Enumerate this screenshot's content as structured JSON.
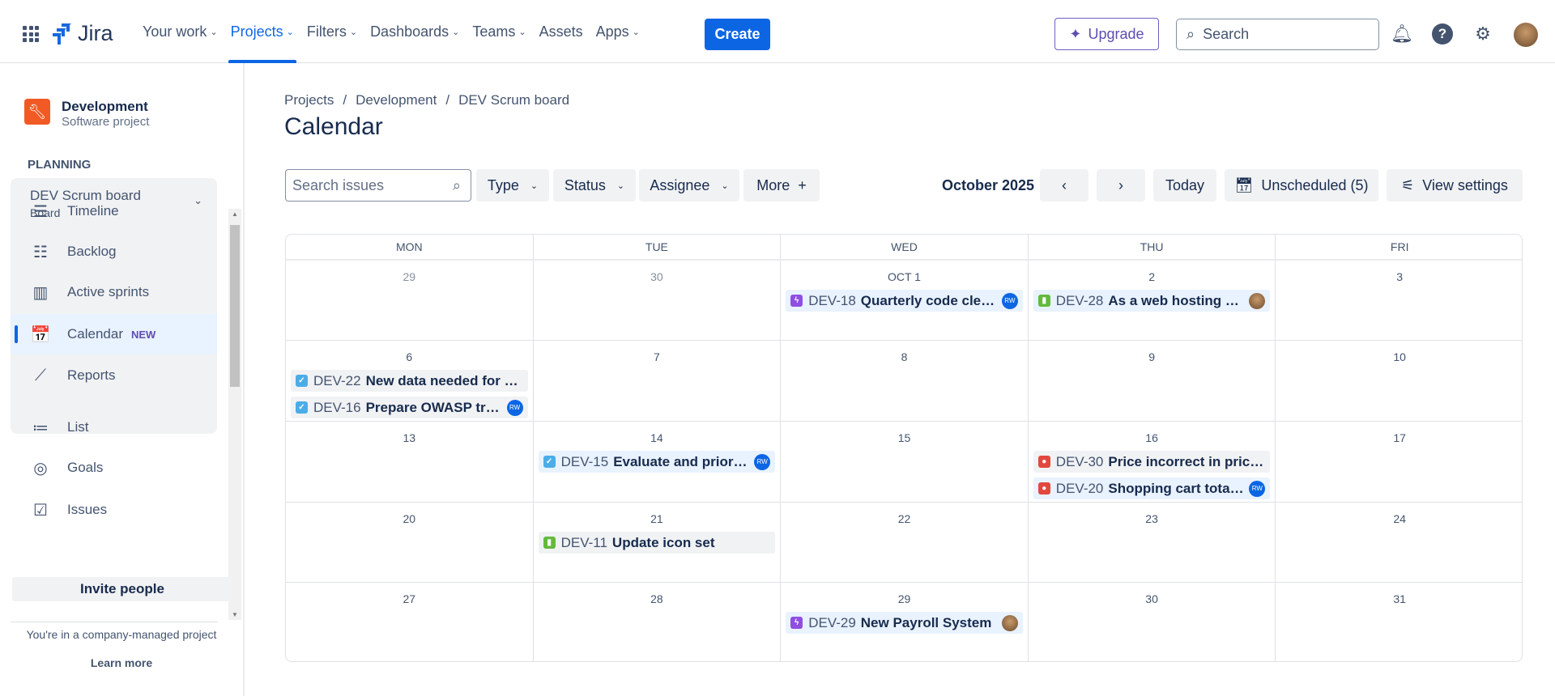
{
  "nav": {
    "logo": "Jira",
    "items": [
      {
        "label": "Your work",
        "chev": true
      },
      {
        "label": "Projects",
        "chev": true,
        "active": true
      },
      {
        "label": "Filters",
        "chev": true
      },
      {
        "label": "Dashboards",
        "chev": true
      },
      {
        "label": "Teams",
        "chev": true
      },
      {
        "label": "Assets",
        "chev": false
      },
      {
        "label": "Apps",
        "chev": true
      }
    ],
    "create": "Create",
    "upgrade": "Upgrade",
    "search_placeholder": "Search"
  },
  "sidebar": {
    "project_name": "Development",
    "project_type": "Software project",
    "section": "PLANNING",
    "board_name": "DEV Scrum board",
    "board_type": "Board",
    "items": [
      {
        "label": "Timeline",
        "icon": "☰"
      },
      {
        "label": "Backlog",
        "icon": "☷"
      },
      {
        "label": "Active sprints",
        "icon": "▥"
      },
      {
        "label": "Calendar",
        "icon": "📅",
        "badge": "NEW"
      },
      {
        "label": "Reports",
        "icon": "⟋"
      },
      {
        "label": "List",
        "icon": "≔"
      },
      {
        "label": "Goals",
        "icon": "◎"
      },
      {
        "label": "Issues",
        "icon": "☑"
      }
    ],
    "invite": "Invite people",
    "company_note": "You're in a company-managed project",
    "learn_more": "Learn more"
  },
  "breadcrumb": [
    "Projects",
    "Development",
    "DEV Scrum board"
  ],
  "title": "Calendar",
  "toolbar": {
    "search_placeholder": "Search issues",
    "filters": [
      "Type",
      "Status",
      "Assignee"
    ],
    "more": "More",
    "month": "October 2025",
    "today": "Today",
    "unscheduled": "Unscheduled (5)",
    "view_settings": "View settings"
  },
  "colors": {
    "task": "#4bade8",
    "story": "#63ba3c",
    "epic": "#904ee2",
    "bug": "#e2483d"
  },
  "calendar": {
    "days": [
      "MON",
      "TUE",
      "WED",
      "THU",
      "FRI"
    ],
    "weeks": [
      [
        {
          "d": "29",
          "muted": true
        },
        {
          "d": "30",
          "muted": true
        },
        {
          "d": "OCT 1",
          "events": [
            {
              "type": "epic",
              "key": "DEV-18",
              "summary": "Quarterly code cleanup",
              "assignee": "RW",
              "blue": true
            }
          ]
        },
        {
          "d": "2",
          "events": [
            {
              "type": "story",
              "key": "DEV-28",
              "summary": "As a web hosting customer",
              "assignee": "photo",
              "blue": true
            }
          ]
        },
        {
          "d": "3"
        }
      ],
      [
        {
          "d": "6",
          "events": [
            {
              "type": "task",
              "key": "DEV-22",
              "summary": "New data needed for campaign"
            },
            {
              "type": "task",
              "key": "DEV-16",
              "summary": "Prepare OWASP training",
              "assignee": "RW"
            }
          ]
        },
        {
          "d": "7"
        },
        {
          "d": "8"
        },
        {
          "d": "9"
        },
        {
          "d": "10"
        }
      ],
      [
        {
          "d": "13"
        },
        {
          "d": "14",
          "events": [
            {
              "type": "task",
              "key": "DEV-15",
              "summary": "Evaluate and prioritize",
              "assignee": "RW",
              "blue": true
            }
          ]
        },
        {
          "d": "15"
        },
        {
          "d": "16",
          "events": [
            {
              "type": "bug",
              "key": "DEV-30",
              "summary": "Price incorrect in pricing page"
            },
            {
              "type": "bug",
              "key": "DEV-20",
              "summary": "Shopping cart total wrong",
              "assignee": "RW",
              "blue": true
            }
          ]
        },
        {
          "d": "17"
        }
      ],
      [
        {
          "d": "20"
        },
        {
          "d": "21",
          "events": [
            {
              "type": "story",
              "key": "DEV-11",
              "summary": "Update icon set"
            }
          ]
        },
        {
          "d": "22"
        },
        {
          "d": "23"
        },
        {
          "d": "24"
        }
      ],
      [
        {
          "d": "27"
        },
        {
          "d": "28"
        },
        {
          "d": "29",
          "events": [
            {
              "type": "epic",
              "key": "DEV-29",
              "summary": "New Payroll System",
              "assignee": "photo",
              "blue": true
            }
          ]
        },
        {
          "d": "30"
        },
        {
          "d": "31"
        }
      ]
    ]
  }
}
